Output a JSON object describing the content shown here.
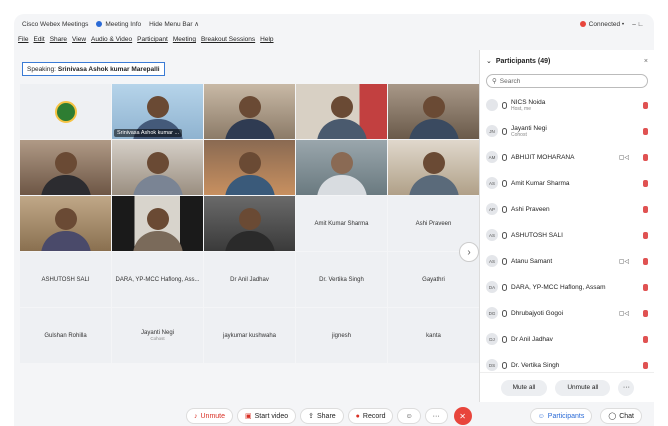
{
  "titlebar": {
    "app_name": "Cisco Webex Meetings",
    "meeting_info": "Meeting Info",
    "hide_menu": "Hide Menu Bar ∧",
    "status": "Connected •",
    "window_controls": "–   ∟"
  },
  "menu": [
    "File",
    "Edit",
    "Share",
    "View",
    "Audio & Video",
    "Participant",
    "Meeting",
    "Breakout Sessions",
    "Help"
  ],
  "speaking": {
    "label": "Speaking:",
    "name": "Srinivasa Ashok kumar Marepalli"
  },
  "active_tile_name": "Srinivasa Ashok kumar ...",
  "name_tiles": [
    {
      "name": "Amit Kumar Sharma",
      "sub": ""
    },
    {
      "name": "Ashi Praveen",
      "sub": ""
    },
    {
      "name": "ASHUTOSH SALI",
      "sub": ""
    },
    {
      "name": "DARA, YP-MCC Haflong, Ass...",
      "sub": ""
    },
    {
      "name": "Dr Anil Jadhav",
      "sub": ""
    },
    {
      "name": "Dr. Vertika Singh",
      "sub": ""
    },
    {
      "name": "Gayathri",
      "sub": ""
    },
    {
      "name": "Gulshan Rohilla",
      "sub": ""
    },
    {
      "name": "Jayanti Negi",
      "sub": "Cohost"
    },
    {
      "name": "jaykumar kushwaha",
      "sub": ""
    },
    {
      "name": "jignesh",
      "sub": ""
    },
    {
      "name": "kanta",
      "sub": ""
    }
  ],
  "next_arrow": "›",
  "participants": {
    "title": "Participants (49)",
    "close": "×",
    "search_placeholder": "Search",
    "items": [
      {
        "initials": "",
        "name": "NICS Noida",
        "role": "Host, me",
        "cam": ""
      },
      {
        "initials": "JN",
        "name": "Jayanti Negi",
        "role": "Cohost",
        "cam": ""
      },
      {
        "initials": "AM",
        "name": "ABHIJIT MOHARANA",
        "role": "",
        "cam": "▢◁"
      },
      {
        "initials": "AS",
        "name": "Amit Kumar Sharma",
        "role": "",
        "cam": ""
      },
      {
        "initials": "AP",
        "name": "Ashi Praveen",
        "role": "",
        "cam": ""
      },
      {
        "initials": "AS",
        "name": "ASHUTOSH SALI",
        "role": "",
        "cam": ""
      },
      {
        "initials": "AS",
        "name": "Atanu Samant",
        "role": "",
        "cam": "▢◁"
      },
      {
        "initials": "DA",
        "name": "DARA, YP-MCC Haflong, Assam",
        "role": "",
        "cam": ""
      },
      {
        "initials": "DG",
        "name": "Dhrubajyoti Gogoi",
        "role": "",
        "cam": "▢◁"
      },
      {
        "initials": "DJ",
        "name": "Dr Anil Jadhav",
        "role": "",
        "cam": ""
      },
      {
        "initials": "DS",
        "name": "Dr. Vertika Singh",
        "role": "",
        "cam": ""
      }
    ],
    "mute_all": "Mute all",
    "unmute_all": "Unmute all",
    "more": "···"
  },
  "toolbar": {
    "unmute": "Unmute",
    "start_video": "Start video",
    "share": "Share",
    "record": "Record",
    "participants": "Participants",
    "chat": "Chat",
    "more": "···"
  },
  "colors": {
    "accent": "#2a6ad6",
    "leave": "#e8453c",
    "muted": "#e05252",
    "active": "#6bd16b"
  }
}
